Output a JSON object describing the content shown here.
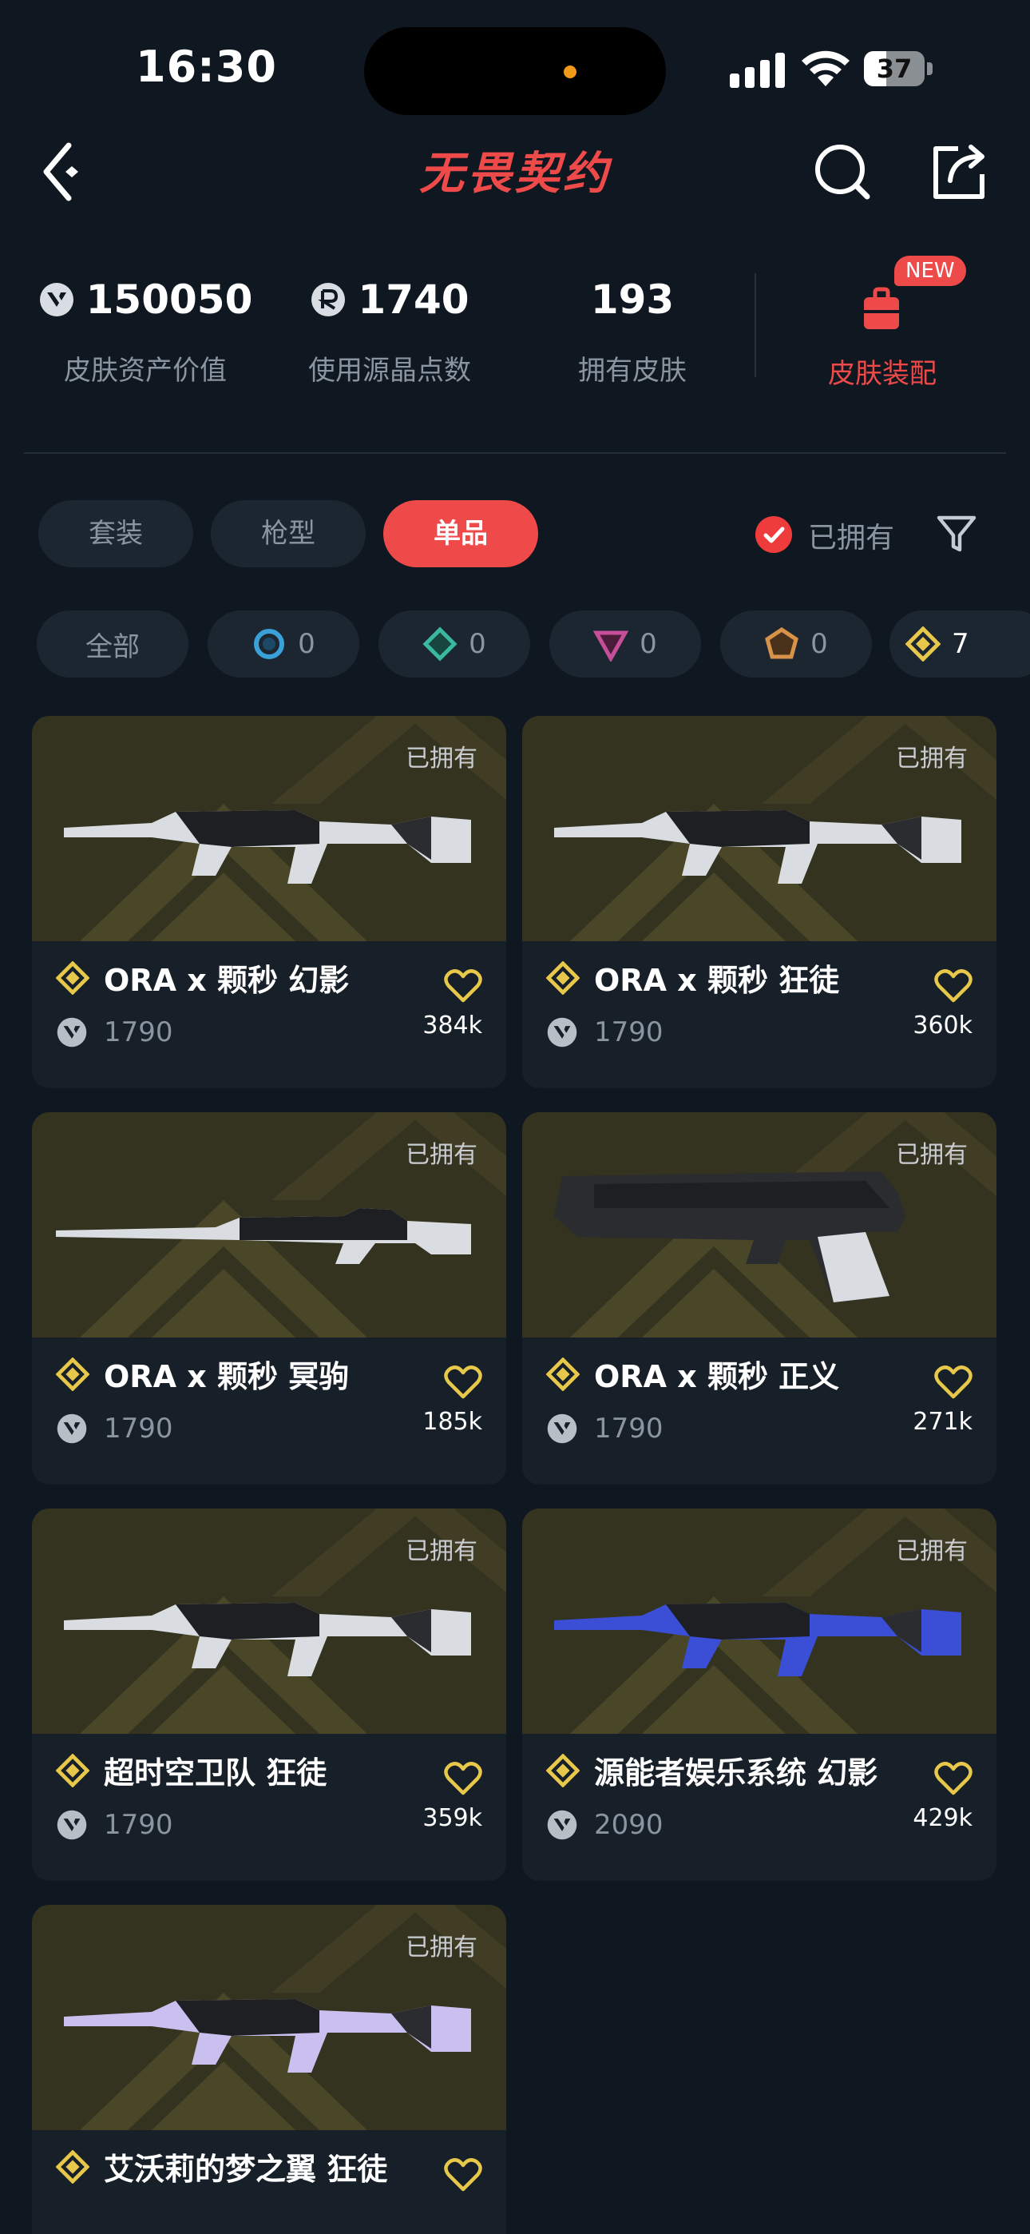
{
  "status_bar": {
    "time": "16:30",
    "battery": "37",
    "battery_level": 0.37
  },
  "nav": {
    "title": "无畏契约",
    "icons": [
      "back-icon",
      "search-icon",
      "share-icon"
    ]
  },
  "stats": [
    {
      "value": "150050",
      "label": "皮肤资产价值",
      "icon": "valorant-points-icon"
    },
    {
      "value": "1740",
      "label": "使用源晶点数",
      "icon": "radianite-icon"
    },
    {
      "value": "193",
      "label": "拥有皮肤",
      "icon": ""
    }
  ],
  "outfit": {
    "badge": "NEW",
    "label": "皮肤装配",
    "icon": "backpack-icon"
  },
  "tabs": [
    {
      "label": "套装",
      "active": false
    },
    {
      "label": "枪型",
      "active": false
    },
    {
      "label": "单品",
      "active": true
    }
  ],
  "owned_filter": {
    "label": "已拥有",
    "checked": true
  },
  "rarity_chips": [
    {
      "label": "全部"
    },
    {
      "count": "0",
      "color": "#3aa0d8",
      "icon": "select-tier-icon"
    },
    {
      "count": "0",
      "color": "#3ab8a0",
      "icon": "deluxe-tier-icon"
    },
    {
      "count": "0",
      "color": "#c64f9a",
      "icon": "premium-tier-icon"
    },
    {
      "count": "0",
      "color": "#d8924a",
      "icon": "exclusive-tier-icon"
    },
    {
      "count": "7",
      "color": "#e8c84a",
      "icon": "ultra-tier-icon"
    }
  ],
  "skins": [
    {
      "name": "ORA x 颗秒 幻影",
      "price": "1790",
      "count": "384k",
      "owned": "已拥有",
      "weapon": "rifle-icon"
    },
    {
      "name": "ORA x 颗秒 狂徒",
      "price": "1790",
      "count": "360k",
      "owned": "已拥有",
      "weapon": "rifle-icon"
    },
    {
      "name": "ORA x 颗秒 冥驹",
      "price": "1790",
      "count": "185k",
      "owned": "已拥有",
      "weapon": "sniper-icon"
    },
    {
      "name": "ORA x 颗秒 正义",
      "price": "1790",
      "count": "271k",
      "owned": "已拥有",
      "weapon": "pistol-icon"
    },
    {
      "name": "超时空卫队 狂徒",
      "price": "1790",
      "count": "359k",
      "owned": "已拥有",
      "weapon": "rifle-icon"
    },
    {
      "name": "源能者娱乐系统 幻影",
      "price": "2090",
      "count": "429k",
      "owned": "已拥有",
      "weapon": "rifle-icon"
    },
    {
      "name": "艾沃莉的梦之翼 狂徒",
      "price": "",
      "count": "",
      "owned": "已拥有",
      "weapon": "rifle-icon"
    }
  ],
  "colors": {
    "accent": "#ee4a4a",
    "background": "#0f1720",
    "ultra": "#e8c84a"
  }
}
